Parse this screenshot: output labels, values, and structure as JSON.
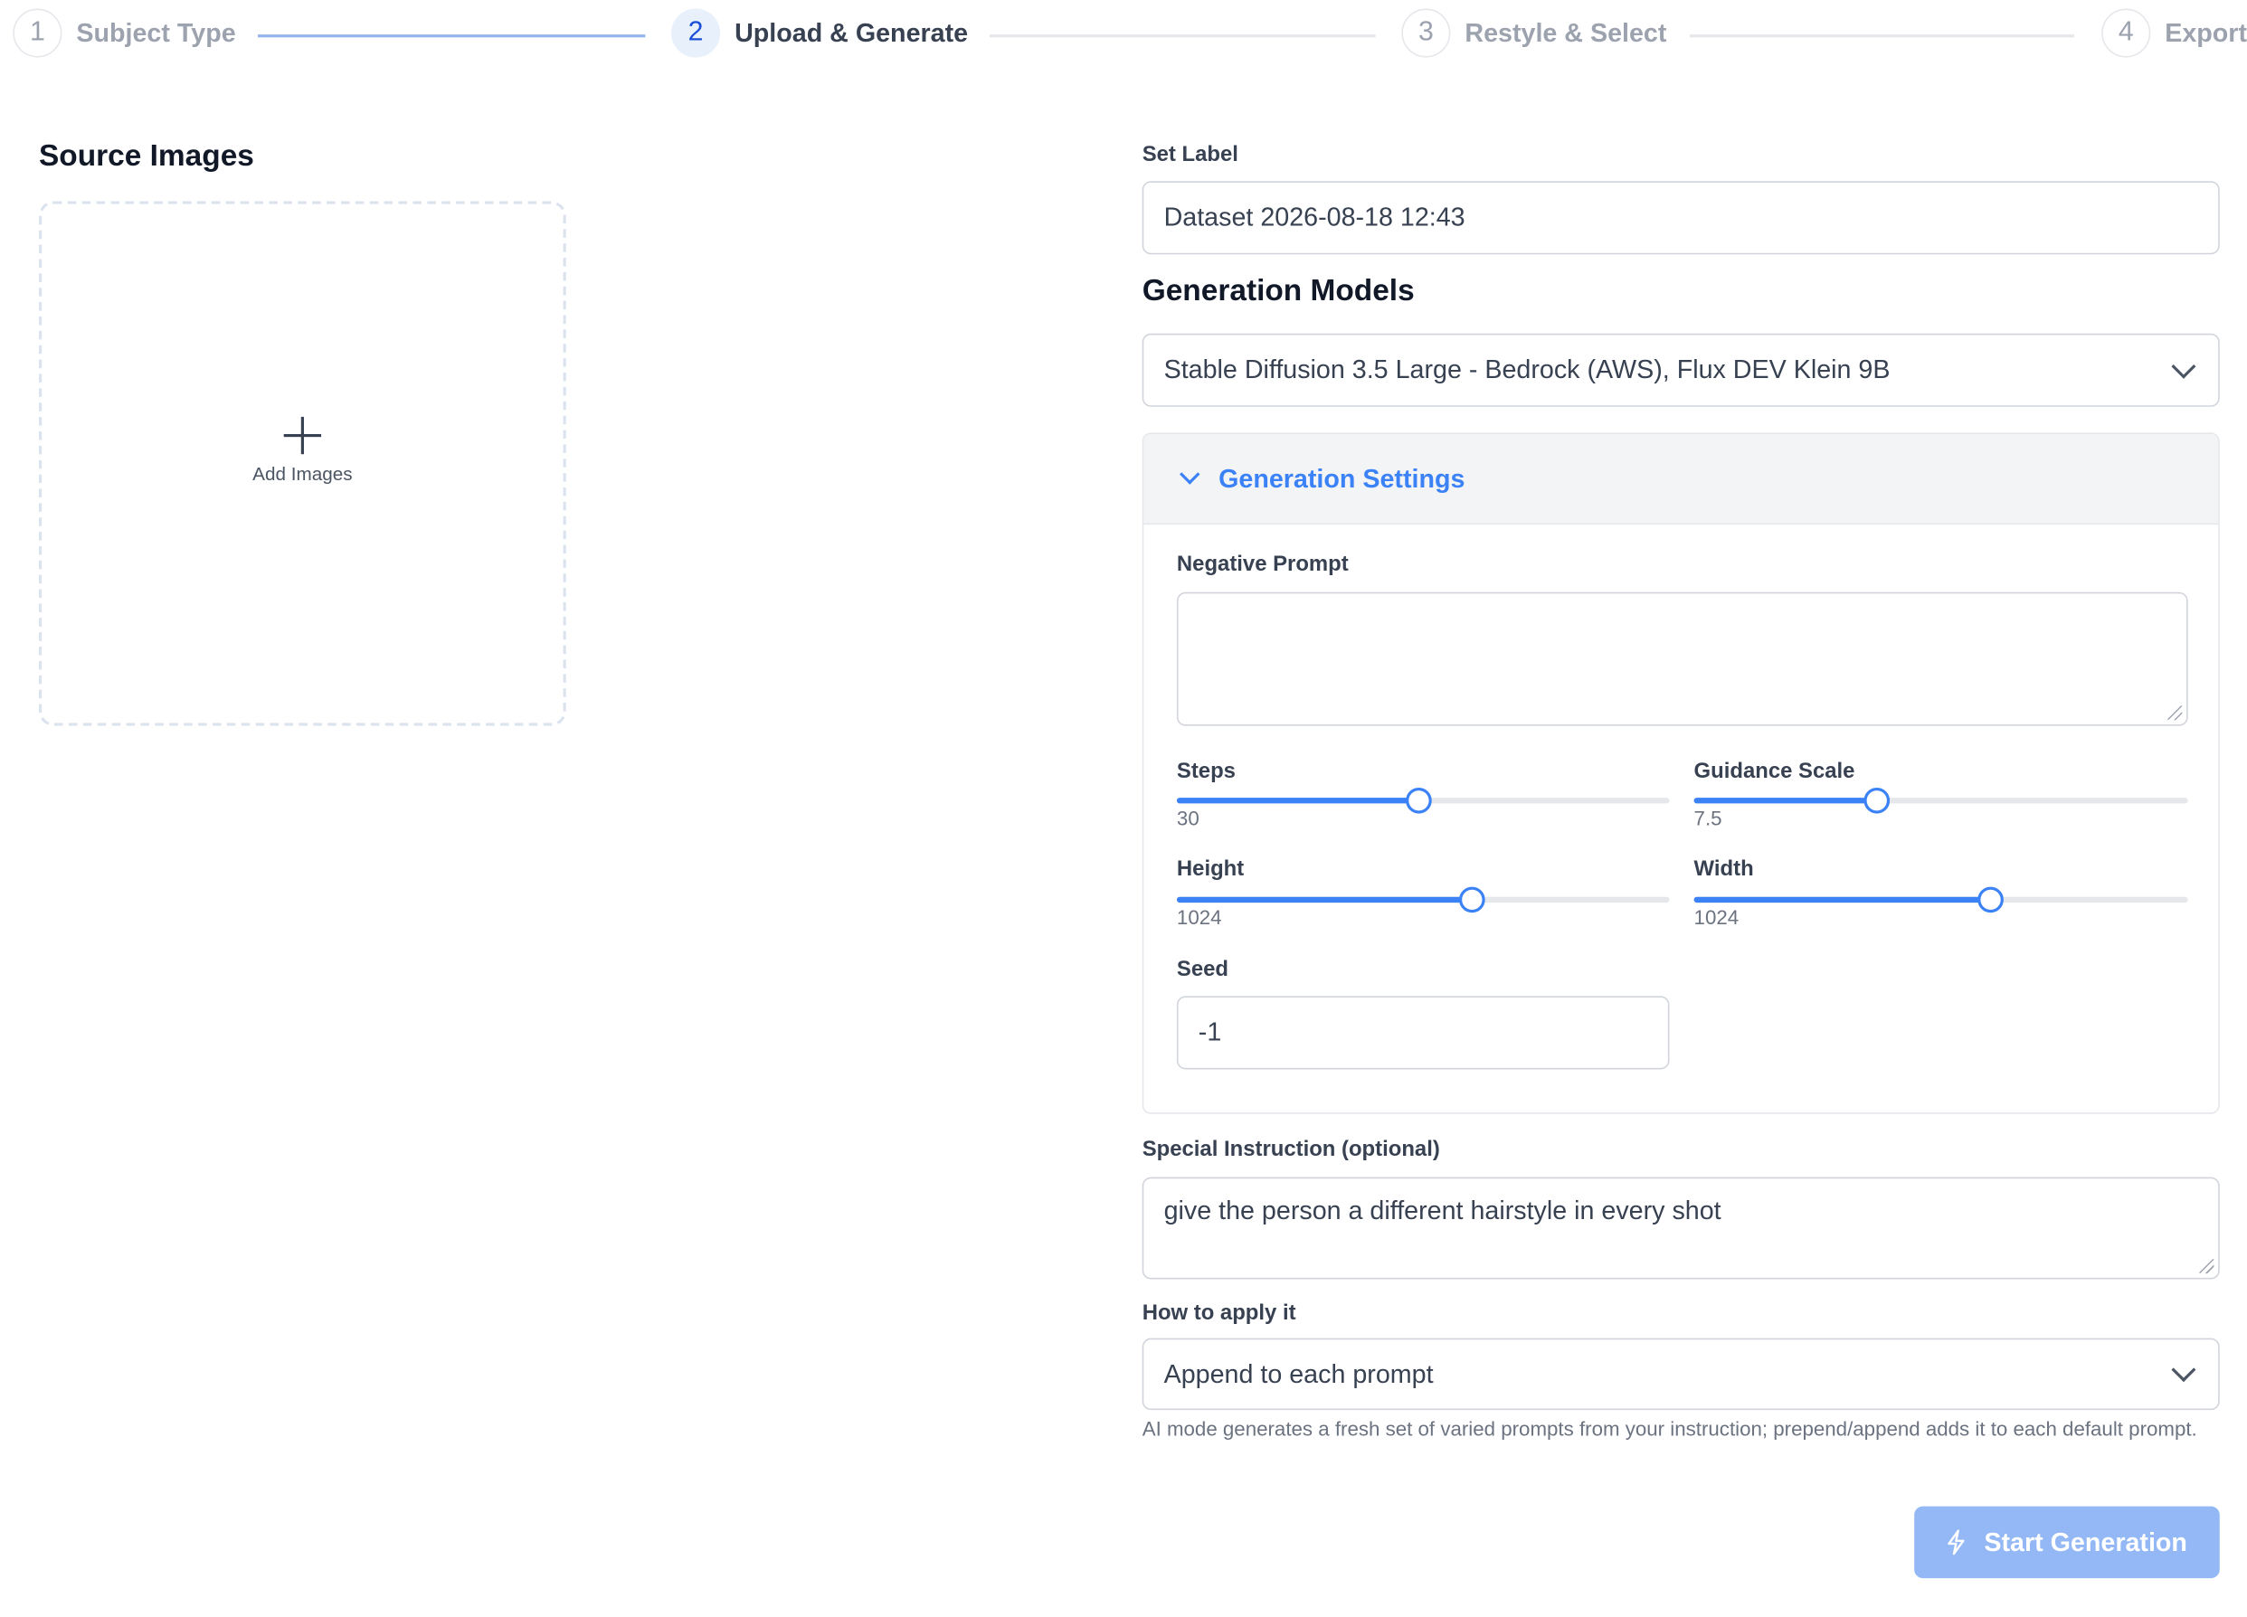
{
  "stepper": {
    "steps": [
      {
        "number": "1",
        "label": "Subject Type",
        "state": "done"
      },
      {
        "number": "2",
        "label": "Upload & Generate",
        "state": "active"
      },
      {
        "number": "3",
        "label": "Restyle & Select",
        "state": "upcoming"
      },
      {
        "number": "4",
        "label": "Export",
        "state": "upcoming"
      }
    ]
  },
  "source": {
    "title": "Source Images",
    "add_label": "Add Images",
    "add_icon": "plus-icon"
  },
  "set_label": {
    "label": "Set Label",
    "value": "Dataset 2026-08-18 12:43"
  },
  "models": {
    "title": "Generation Models",
    "selected": "Stable Diffusion 3.5 Large - Bedrock (AWS), Flux DEV Klein 9B"
  },
  "settings": {
    "title": "Generation Settings",
    "expanded": true,
    "negative_prompt": {
      "label": "Negative Prompt",
      "value": ""
    },
    "steps": {
      "label": "Steps",
      "value": "30",
      "fraction": 0.49
    },
    "guidance_scale": {
      "label": "Guidance Scale",
      "value": "7.5",
      "fraction": 0.37
    },
    "height": {
      "label": "Height",
      "value": "1024",
      "fraction": 0.6
    },
    "width": {
      "label": "Width",
      "value": "1024",
      "fraction": 0.6
    },
    "seed": {
      "label": "Seed",
      "value": "-1"
    }
  },
  "special_instruction": {
    "label": "Special Instruction (optional)",
    "value": "give the person a different hairstyle in every shot"
  },
  "apply_mode": {
    "label": "How to apply it",
    "selected": "Append to each prompt",
    "helper": "AI mode generates a fresh set of varied prompts from your instruction; prepend/append adds it to each default prompt."
  },
  "start_button": {
    "label": "Start Generation",
    "icon": "bolt-icon"
  },
  "colors": {
    "accent": "#3b82f6",
    "button_disabled": "#93b8f5",
    "panel_header": "#f3f4f6"
  }
}
